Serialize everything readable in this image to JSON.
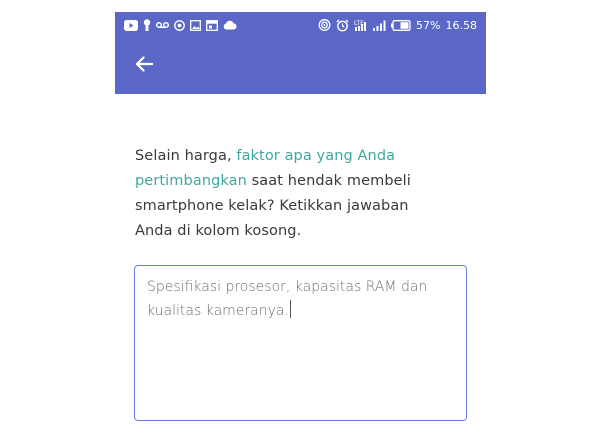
{
  "status_bar": {
    "battery_percent": "57%",
    "time": "16.58",
    "left_icons": [
      "youtube-icon",
      "keyhole-icon",
      "voicemail-icon",
      "instagram-icon",
      "gallery-icon",
      "calendar-icon",
      "cloud-icon"
    ],
    "right_icons": [
      "hotspot-icon",
      "alarm-icon",
      "lte-signal-icon",
      "signal-icon",
      "battery-icon"
    ]
  },
  "app_bar": {
    "back_icon": "arrow-left-icon",
    "color": "#5a67c7"
  },
  "question": {
    "part1": "Selain harga, ",
    "highlight": "faktor apa yang Anda pertimbangkan",
    "part2": " saat hendak membeli smartphone kelak? Ketikkan jawaban Anda di kolom kosong.",
    "highlight_color": "#3fa7a1"
  },
  "answer_field": {
    "value": "Spesifikasi prosesor,  kapasitas RAM dan kualitas kameranya.",
    "border_color": "#6a7de0"
  }
}
